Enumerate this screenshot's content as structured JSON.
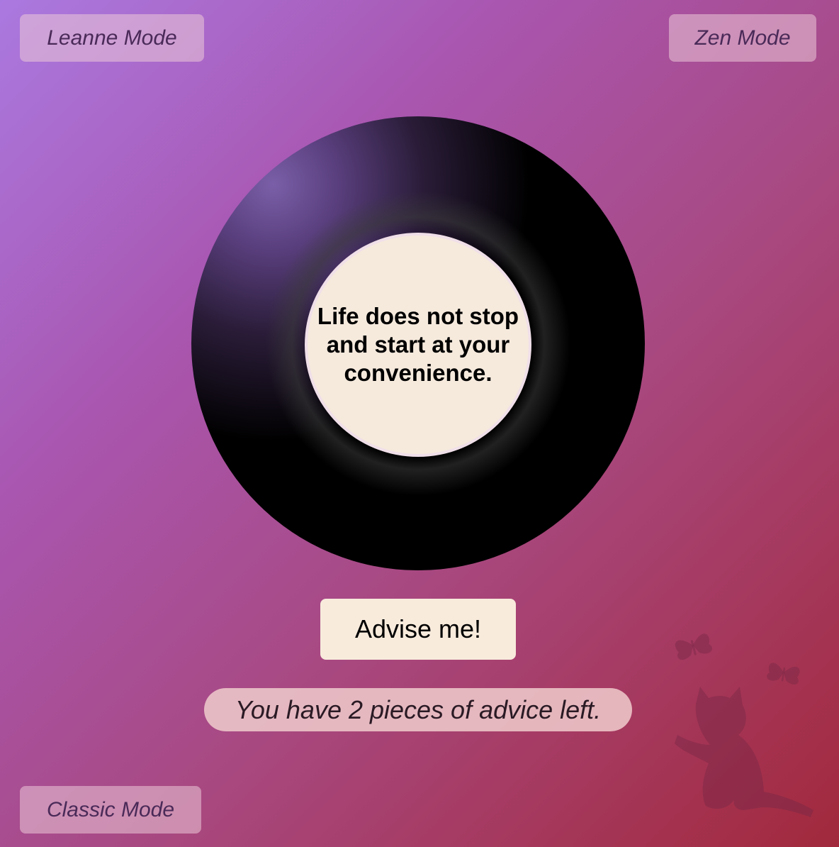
{
  "modes": {
    "leanne": "Leanne Mode",
    "zen": "Zen Mode",
    "classic": "Classic Mode"
  },
  "ball": {
    "answer": "Life does not stop and start at your convenience."
  },
  "advise_button": "Advise me!",
  "advice_remaining": "You have 2 pieces of advice left.",
  "decoration": [
    "butterfly-icon",
    "butterfly-icon",
    "cat-icon"
  ]
}
